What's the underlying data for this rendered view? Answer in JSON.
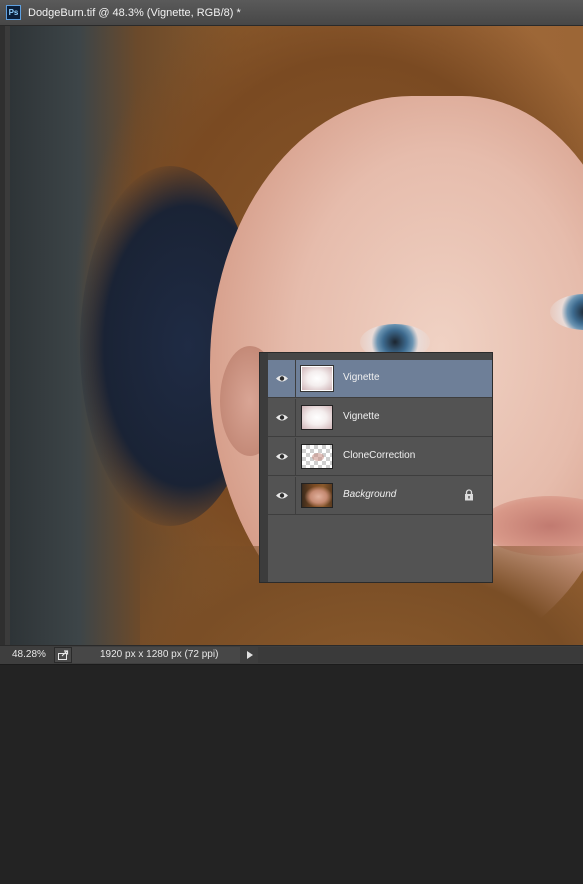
{
  "document": {
    "app_icon_text": "Ps",
    "title": "DodgeBurn.tif @ 48.3% (Vignette, RGB/8) *"
  },
  "canvas": {
    "image_description_icon": "photo-canvas"
  },
  "status_bar": {
    "zoom": "48.28%",
    "doc_info": "1920 px x 1280 px (72 ppi)",
    "share_icon": "share-icon",
    "menu_arrow_icon": "triangle-right-icon"
  },
  "layers_panel": {
    "layers": [
      {
        "name": "Vignette",
        "thumb": "vignette",
        "visible": true,
        "selected": true,
        "locked": false,
        "italic": false
      },
      {
        "name": "Vignette",
        "thumb": "vignette",
        "visible": true,
        "selected": false,
        "locked": false,
        "italic": false
      },
      {
        "name": "CloneCorrection",
        "thumb": "transparent-checker",
        "visible": true,
        "selected": false,
        "locked": false,
        "italic": false
      },
      {
        "name": "Background",
        "thumb": "photo",
        "visible": true,
        "selected": false,
        "locked": true,
        "italic": true
      }
    ],
    "selected_color": "#6e7f98"
  }
}
